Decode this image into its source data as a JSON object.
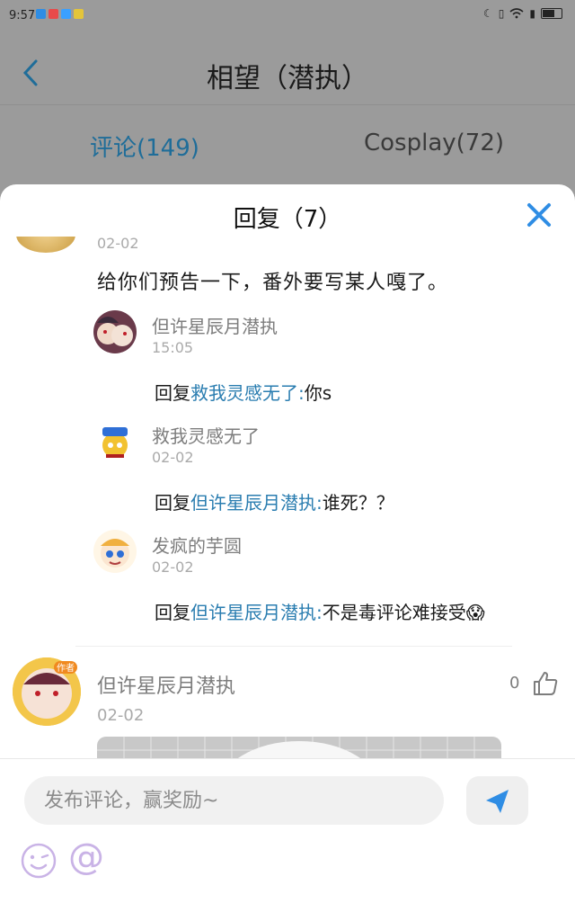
{
  "status_bar": {
    "time": "9:57",
    "app_colors": [
      "#2f8de4",
      "#e84a4a",
      "#3aa0ff",
      "#e4c53a"
    ],
    "icons": [
      "moon-icon",
      "vibrate-icon",
      "wifi-icon",
      "sim-alert-icon",
      "battery-icon"
    ]
  },
  "background_page": {
    "title": "相望（潜执）",
    "tabs": [
      {
        "label": "评论(149)",
        "active": true
      },
      {
        "label": "Cosplay(72)",
        "active": false
      }
    ]
  },
  "sheet": {
    "title": "回复（7）",
    "top_comment": {
      "date": "02-02",
      "text": "给你们预告一下，番外要写某人嘎了。"
    },
    "replies": [
      {
        "name": "但许星辰月潜执",
        "date": "15:05",
        "prefix": "回复",
        "target": "救我灵感无了:",
        "text": "你s"
      },
      {
        "name": "救我灵感无了",
        "date": "02-02",
        "prefix": "回复",
        "target": "但许星辰月潜执:",
        "text": "谁死？？"
      },
      {
        "name": "发疯的芋圆",
        "date": "02-02",
        "prefix": "回复",
        "target": "但许星辰月潜执:",
        "text": "不是毒评论难接受😱"
      }
    ],
    "next_comment": {
      "name": "但许星辰月潜执",
      "date": "02-02",
      "likes": "0",
      "badge": "作者"
    }
  },
  "composer": {
    "placeholder": "发布评论，赢奖励~",
    "at_symbol": "@"
  },
  "colors": {
    "accent_blue": "#2a7db0",
    "dim_overlay": "#9b9b9b"
  }
}
